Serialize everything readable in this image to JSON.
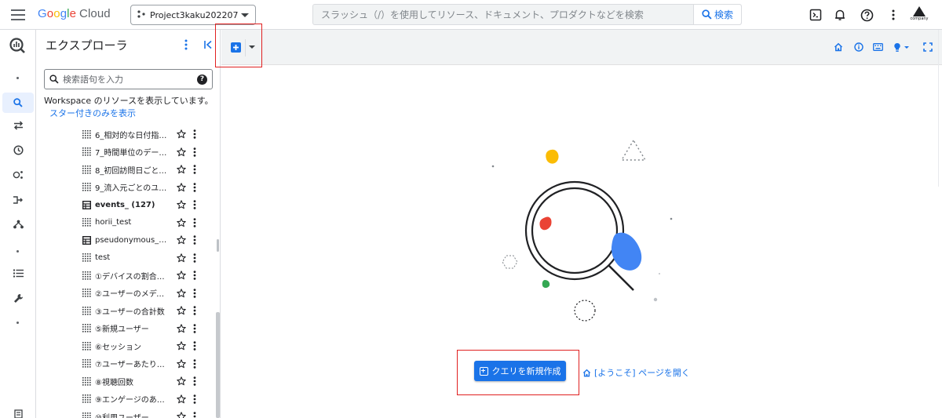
{
  "header": {
    "logo_google": [
      "G",
      "o",
      "o",
      "g",
      "l",
      "e"
    ],
    "logo_cloud": "Cloud",
    "project_name": "Project3kaku202207",
    "search_placeholder": "スラッシュ（/）を使用してリソース、ドキュメント、プロダクトなどを検索",
    "search_button": "検索",
    "company_label": "company"
  },
  "explorer": {
    "title": "エクスプローラ",
    "search_placeholder": "検索語句を入力",
    "info_text": "Workspace のリソースを表示しています。",
    "starred_link": "スター付きのみを表示",
    "rows": [
      {
        "label": "6_相対的な日付指定...",
        "type": "query",
        "bold": false
      },
      {
        "label": "7_時間単位のデータ...",
        "type": "query",
        "bold": false
      },
      {
        "label": "8_初回訪問日ごとの...",
        "type": "query",
        "bold": false
      },
      {
        "label": "9_流入元ごとのユー...",
        "type": "query",
        "bold": false
      },
      {
        "label": "events_ (127)",
        "type": "table",
        "bold": true
      },
      {
        "label": "horii_test",
        "type": "query",
        "bold": false
      },
      {
        "label": "pseudonymous_user...",
        "type": "table",
        "bold": false
      },
      {
        "label": "test",
        "type": "query",
        "bold": false
      },
      {
        "label": "①デバイスの割合を...",
        "type": "query",
        "bold": false
      },
      {
        "label": "②ユーザーのメディ...",
        "type": "query",
        "bold": false
      },
      {
        "label": "③ユーザーの合計数",
        "type": "query",
        "bold": false
      },
      {
        "label": "⑤新規ユーザー",
        "type": "query",
        "bold": false
      },
      {
        "label": "⑥セッション",
        "type": "query",
        "bold": false
      },
      {
        "label": "⑦ユーザーあたりの...",
        "type": "query",
        "bold": false
      },
      {
        "label": "⑧視聴回数",
        "type": "query",
        "bold": false
      },
      {
        "label": "⑨エンゲージのあっ...",
        "type": "query",
        "bold": false
      },
      {
        "label": "⑩利用ユーザー",
        "type": "query",
        "bold": false
      }
    ]
  },
  "main": {
    "create_query_button": "クエリを新規作成",
    "welcome_link": "[ようこそ] ページを開く"
  },
  "colors": {
    "accent": "#1a73e8",
    "highlight_box": "#e02020",
    "toolbar_bg": "#f1f3f4"
  }
}
